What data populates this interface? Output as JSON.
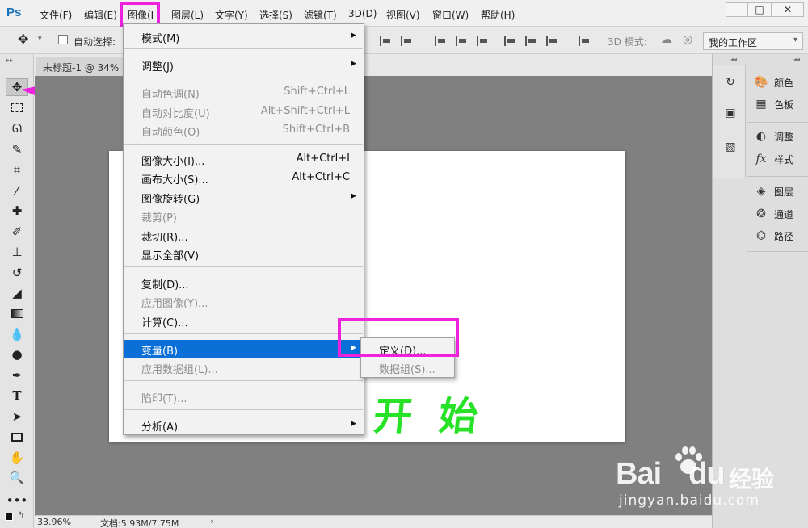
{
  "app": {
    "logo": "Ps"
  },
  "menubar": {
    "items": [
      "文件(F)",
      "编辑(E)",
      "图像(I",
      "图层(L)",
      "文字(Y)",
      "选择(S)",
      "滤镜(T)",
      "3D(D)",
      "视图(V)",
      "窗口(W)",
      "帮助(H)"
    ]
  },
  "window_controls": {
    "minimize": "—",
    "maximize": "□",
    "close": "✕"
  },
  "options": {
    "auto_select_label": "自动选择:",
    "mode_3d_label": "3D 模式:",
    "workspace": "我的工作区"
  },
  "document": {
    "tab_title": "未标题-1 @ 34%",
    "canvas_text": "开 始"
  },
  "status": {
    "zoom": "33.96%",
    "doc_size": "文档:5.93M/7.75M"
  },
  "image_menu": {
    "items": [
      {
        "label": "模式(M)",
        "shortcut": "",
        "submenu": true,
        "disabled": false
      },
      {
        "label": "调整(J)",
        "shortcut": "",
        "submenu": true,
        "disabled": false
      },
      {
        "label": "自动色调(N)",
        "shortcut": "Shift+Ctrl+L",
        "submenu": false,
        "disabled": true
      },
      {
        "label": "自动对比度(U)",
        "shortcut": "Alt+Shift+Ctrl+L",
        "submenu": false,
        "disabled": true
      },
      {
        "label": "自动颜色(O)",
        "shortcut": "Shift+Ctrl+B",
        "submenu": false,
        "disabled": true
      },
      {
        "label": "图像大小(I)...",
        "shortcut": "Alt+Ctrl+I",
        "submenu": false,
        "disabled": false
      },
      {
        "label": "画布大小(S)...",
        "shortcut": "Alt+Ctrl+C",
        "submenu": false,
        "disabled": false
      },
      {
        "label": "图像旋转(G)",
        "shortcut": "",
        "submenu": true,
        "disabled": false
      },
      {
        "label": "裁剪(P)",
        "shortcut": "",
        "submenu": false,
        "disabled": true
      },
      {
        "label": "裁切(R)...",
        "shortcut": "",
        "submenu": false,
        "disabled": false
      },
      {
        "label": "显示全部(V)",
        "shortcut": "",
        "submenu": false,
        "disabled": false
      },
      {
        "label": "复制(D)...",
        "shortcut": "",
        "submenu": false,
        "disabled": false
      },
      {
        "label": "应用图像(Y)...",
        "shortcut": "",
        "submenu": false,
        "disabled": true
      },
      {
        "label": "计算(C)...",
        "shortcut": "",
        "submenu": false,
        "disabled": false
      },
      {
        "label": "变量(B)",
        "shortcut": "",
        "submenu": true,
        "disabled": false,
        "active": true
      },
      {
        "label": "应用数据组(L)...",
        "shortcut": "",
        "submenu": false,
        "disabled": true
      },
      {
        "label": "陷印(T)...",
        "shortcut": "",
        "submenu": false,
        "disabled": true
      },
      {
        "label": "分析(A)",
        "shortcut": "",
        "submenu": true,
        "disabled": false
      }
    ]
  },
  "variables_submenu": {
    "items": [
      {
        "label": "定义(D)...",
        "disabled": false
      },
      {
        "label": "数据组(S)...",
        "disabled": true
      }
    ]
  },
  "panels": {
    "items": [
      "颜色",
      "色板",
      "调整",
      "样式",
      "图层",
      "通道",
      "路径"
    ]
  },
  "watermark": {
    "logo": "Bai",
    "logo_tail": "du",
    "cn": "经验",
    "url": "jingyan.baidu.com"
  },
  "colors": {
    "accent_highlight": "#ee22dd",
    "menu_active": "#0a6fd6",
    "canvas_text": "#27e227",
    "workspace_bg": "#808080"
  }
}
